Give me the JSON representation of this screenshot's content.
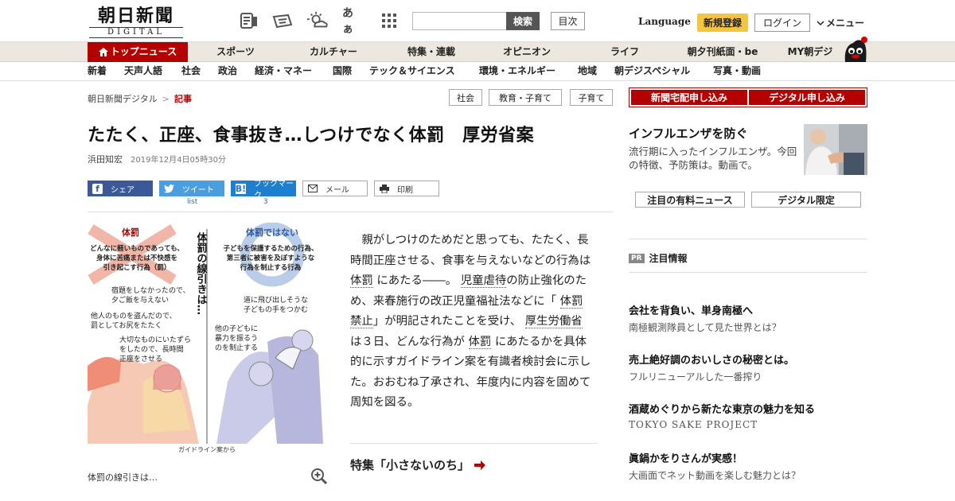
{
  "header": {
    "logo_jp": "朝日新聞",
    "logo_en": "DIGITAL",
    "search_button": "検索",
    "search_placeholder": "",
    "toc_button": "目次",
    "language": "Language",
    "register": "新規登録",
    "login": "ログイン",
    "menu": "メニュー",
    "icons": [
      "paper-icon",
      "digital-edition-icon",
      "weather-icon",
      "font-size-icon",
      "grid-apps-icon"
    ],
    "font_size_glyph": "あぁ"
  },
  "nav1": {
    "items": [
      "トップニュース",
      "スポーツ",
      "カルチャー",
      "特集・連載",
      "オピニオン",
      "ライフ",
      "朝夕刊紙面・be",
      "MY朝デジ"
    ]
  },
  "nav2": {
    "items": [
      "新着",
      "天声人語",
      "社会",
      "政治",
      "経済・マネー",
      "国際",
      "テック＆サイエンス",
      "環境・エネルギー",
      "地域",
      "朝デジスペシャル",
      "写真・動画"
    ]
  },
  "breadcrumb": {
    "home": "朝日新聞デジタル",
    "sep": ">",
    "current": "記事"
  },
  "tags": [
    "社会",
    "教育・子育て",
    "子育て"
  ],
  "article": {
    "title": "たたく、正座、食事抜き…しつけでなく体罰　厚労省案",
    "author": "浜田知宏",
    "date": "2019年12月4日05時30分",
    "share": {
      "facebook": "シェア",
      "twitter": "ツイート",
      "twitter_count": "list",
      "hatena": "ブックマーク",
      "hatena_count": "3",
      "mail": "メール",
      "print": "印刷"
    },
    "body": {
      "p1": "親がしつけのためだと思っても、たたく、長時間正座させる、食事を与えないなどの行為は",
      "kw1": "体罰",
      "p2": "にあたる――。",
      "kw2": "児童虐待",
      "p3": "の防止強化のため、来春施行の改正児童福祉法などに「",
      "kw3": "体罰",
      "kw4": "禁止",
      "p4": "」が明記されたことを受け、",
      "kw5": "厚生労働省",
      "p5": "は３日、どんな行為が",
      "kw6": "体罰",
      "p6": "にあたるかを具体的に示すガイドライン案を有識者検討会に示した。おおむね了承され、年度内に内容を固めて周知を図る。"
    },
    "feature": "特集「小さないのち」",
    "image_caption": "体罰の線引きは…",
    "illustration": {
      "left_head": "体罰",
      "left_lead1": "どんなに軽いものであっても、",
      "left_lead2": "身体に苦痛または不快感を",
      "left_lead3": "引き起こす行為（罰）",
      "left_ex1a": "宿題をしなかったので、",
      "left_ex1b": "夕ご飯を与えない",
      "left_ex2a": "他人のものを盗んだので、",
      "left_ex2b": "罰としてお尻をたたく",
      "left_ex3a": "大切なものにいたずら",
      "left_ex3b": "をしたので、長時間",
      "left_ex3c": "正座をさせる",
      "center_v": "体罰の線引きは…",
      "right_head": "体罰ではない",
      "right_lead1": "子どもを保護するための行為、",
      "right_lead2": "第三者に被害を及ぼすような",
      "right_lead3": "行為を制止する行為",
      "right_ex1a": "道に飛び出しそうな",
      "right_ex1b": "子どもの手をつかむ",
      "right_ex2a": "他の子どもに",
      "right_ex2b": "暴力を振るう",
      "right_ex2c": "のを制止する",
      "source": "ガイドライン案から"
    }
  },
  "sidebar": {
    "subscribe_paper": "新聞宅配申し込み",
    "subscribe_digital": "デジタル申し込み",
    "flu_title": "インフルエンザを防ぐ",
    "flu_desc": "流行期に入ったインフルエンザ。今回の特徴、予防策は。動画で。",
    "tab_paid": "注目の有料ニュース",
    "tab_digital": "デジタル限定",
    "pr_badge": "PR",
    "pr_heading": "注目情報",
    "pr_items": [
      {
        "title": "会社を背負い、単身南極へ",
        "sub": "南極観測隊員として見た世界とは？"
      },
      {
        "title": "売上絶好調のおいしさの秘密とは。",
        "sub": "フルリニューアルした一番搾り"
      },
      {
        "title": "酒蔵めぐりから新たな東京の魅力を知る",
        "sub": "TOKYO SAKE PROJECT"
      },
      {
        "title": "眞鍋かをりさんが実感！",
        "sub": "大画面でネット動画を楽しむ魅力とは？"
      }
    ]
  },
  "colors": {
    "brand_red": "#b50000",
    "nav_bg": "#ece8df",
    "register_yellow": "#f4c63d",
    "facebook": "#3b5998",
    "twitter": "#4a9ee0",
    "hatena": "#1e7ecf"
  }
}
